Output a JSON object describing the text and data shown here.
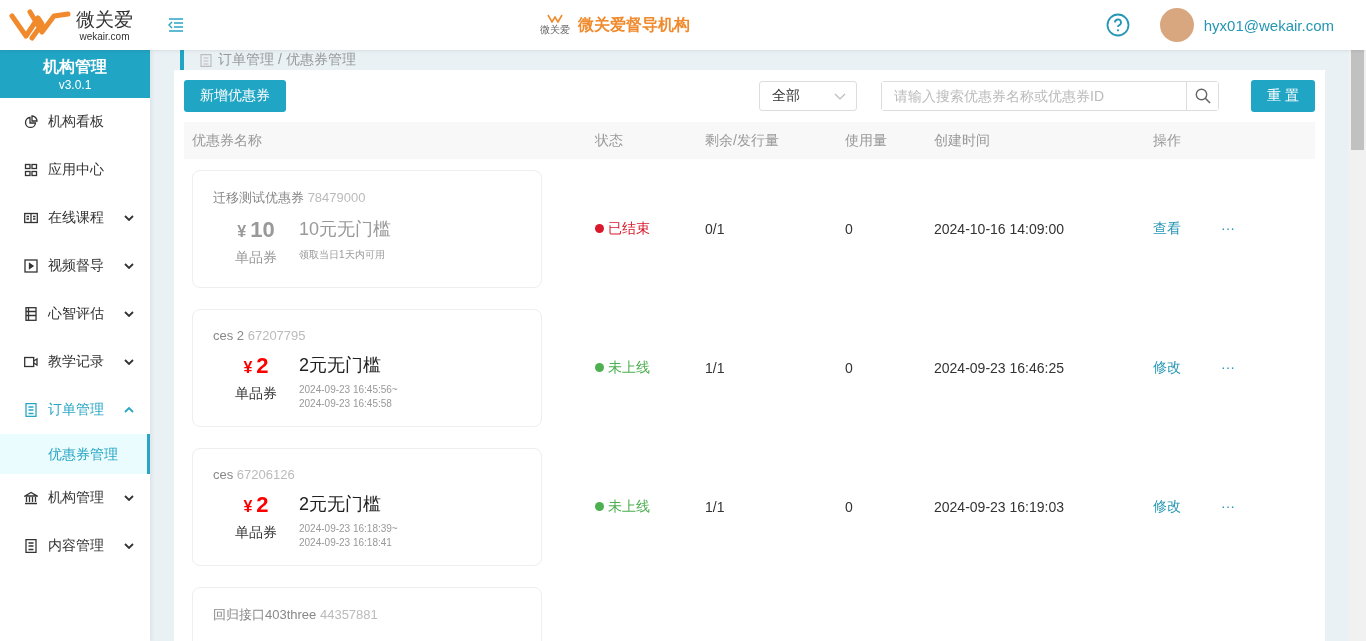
{
  "header": {
    "logo_text": "微关爱",
    "logo_domain": "wekair.com",
    "center_logo_text": "微关爱",
    "org_title": "微关爱督导机构",
    "user_email": "hyx01@wekair.com"
  },
  "sidebar": {
    "title": "机构管理",
    "version": "v3.0.1",
    "items": [
      {
        "label": "机构看板",
        "selected": false
      },
      {
        "label": "应用中心",
        "selected": false
      },
      {
        "label": "在线课程",
        "selected": false,
        "expanded": false
      },
      {
        "label": "视频督导",
        "selected": false,
        "expanded": false
      },
      {
        "label": "心智评估",
        "selected": false,
        "expanded": false
      },
      {
        "label": "教学记录",
        "selected": false,
        "expanded": false
      },
      {
        "label": "订单管理",
        "selected": true,
        "expanded": true,
        "children": [
          {
            "label": "优惠券管理",
            "selected": true
          }
        ]
      },
      {
        "label": "机构管理",
        "selected": false,
        "expanded": false
      },
      {
        "label": "内容管理",
        "selected": false,
        "expanded": false
      }
    ]
  },
  "breadcrumb": "订单管理 / 优惠券管理",
  "toolbar": {
    "add_button": "新增优惠券",
    "filter_value": "全部",
    "search_placeholder": "请输入搜索优惠券名称或优惠券ID",
    "reset_button": "重 置"
  },
  "table": {
    "columns": [
      "优惠券名称",
      "状态",
      "剩余/发行量",
      "使用量",
      "创建时间",
      "操作"
    ],
    "rows": [
      {
        "coupon": {
          "name": "迁移测试优惠券",
          "id": "78479000",
          "currency": "¥",
          "amount": "10",
          "type": "单品券",
          "title": "10元无门槛",
          "validity": [
            "领取当日1天内可用"
          ],
          "expired": true
        },
        "status": {
          "label": "已结束",
          "color": "#d9192b"
        },
        "remaining": "0/1",
        "usage": "0",
        "created": "2024-10-16 14:09:00",
        "action": "查看",
        "more": "···"
      },
      {
        "coupon": {
          "name": "ces 2",
          "id": "67207795",
          "currency": "¥",
          "amount": "2",
          "type": "单品券",
          "title": "2元无门槛",
          "validity": [
            "2024-09-23 16:45:56~",
            "2024-09-23 16:45:58"
          ],
          "expired": false
        },
        "status": {
          "label": "未上线",
          "color": "#4caf50"
        },
        "remaining": "1/1",
        "usage": "0",
        "created": "2024-09-23 16:46:25",
        "action": "修改",
        "more": "···"
      },
      {
        "coupon": {
          "name": "ces",
          "id": "67206126",
          "currency": "¥",
          "amount": "2",
          "type": "单品券",
          "title": "2元无门槛",
          "validity": [
            "2024-09-23 16:18:39~",
            "2024-09-23 16:18:41"
          ],
          "expired": false
        },
        "status": {
          "label": "未上线",
          "color": "#4caf50"
        },
        "remaining": "1/1",
        "usage": "0",
        "created": "2024-09-23 16:19:03",
        "action": "修改",
        "more": "···"
      },
      {
        "coupon": {
          "name": "回归接口403three",
          "id": "44357881"
        }
      }
    ]
  }
}
